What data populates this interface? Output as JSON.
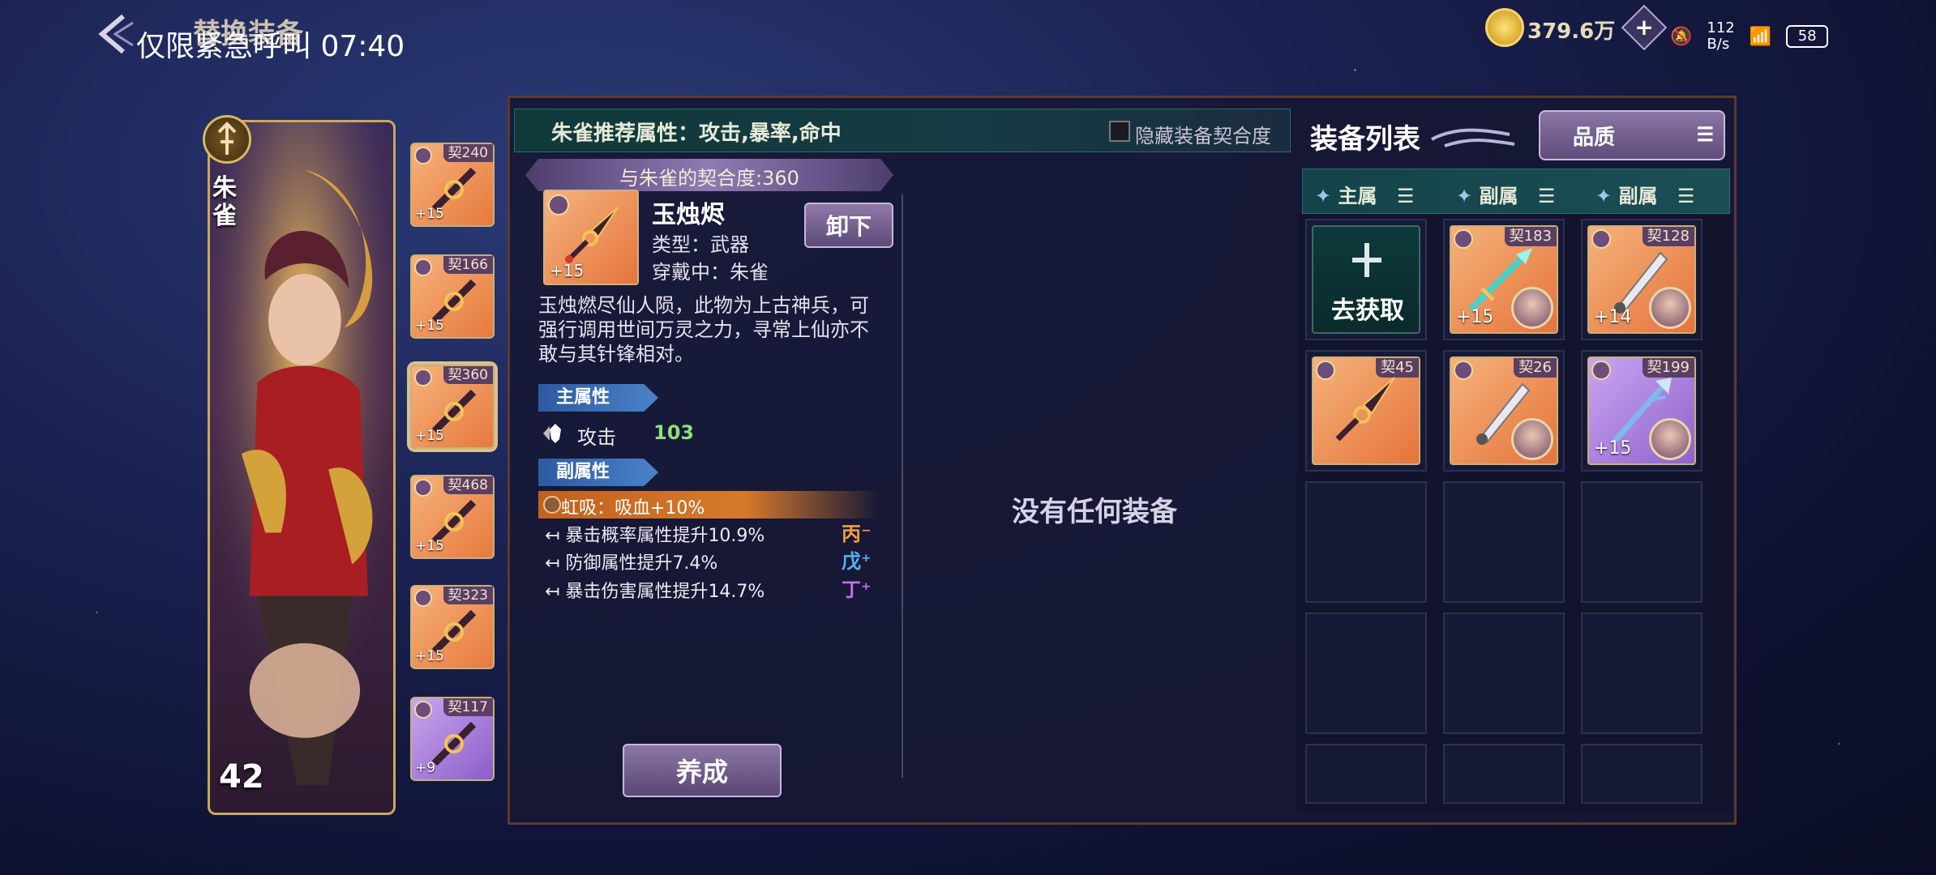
{
  "status_bar": {
    "carrier": "仅限紧急呼叫",
    "time": "07:40",
    "net_speed": "112\nB/s",
    "battery": "58"
  },
  "header": {
    "title": "替换装备",
    "currency_value": "379.6万"
  },
  "character": {
    "name": "朱雀",
    "level": "42"
  },
  "equipped_slots": [
    {
      "qiao": "契240",
      "level": "+15",
      "rarity": "orange"
    },
    {
      "qiao": "契166",
      "level": "+15",
      "rarity": "orange"
    },
    {
      "qiao": "契360",
      "level": "+15",
      "rarity": "orange",
      "selected": true
    },
    {
      "qiao": "契468",
      "level": "+15",
      "rarity": "orange"
    },
    {
      "qiao": "契323",
      "level": "+15",
      "rarity": "orange"
    },
    {
      "qiao": "契117",
      "level": "+9",
      "rarity": "purple"
    }
  ],
  "detail": {
    "recommend_text": "朱雀推荐属性：攻击,暴率,命中",
    "hide_qiao_label": "隐藏装备契合度",
    "qiao_bar": "与朱雀的契合度:360",
    "item_level": "+15",
    "item_name": "玉烛烬",
    "item_type": "类型：武器",
    "item_wearing": "穿戴中：朱雀",
    "unequip_label": "卸下",
    "description": "玉烛燃尽仙人陨，此物为上古神兵，可强行调用世间万灵之力，寻常上仙亦不敢与其针锋相对。",
    "main_attr_header": "主属性",
    "main_attr_name": "攻击",
    "main_attr_value": "103",
    "sub_attr_header": "副属性",
    "special_attr": "虹吸：吸血+10%",
    "sub_attrs": [
      {
        "text": "暴击概率属性提升10.9%",
        "tag": "丙⁻",
        "tag_color": "#f0a040"
      },
      {
        "text": "防御属性提升7.4%",
        "tag": "戊⁺",
        "tag_color": "#5ab0f0"
      },
      {
        "text": "暴击伤害属性提升14.7%",
        "tag": "丁⁺",
        "tag_color": "#c56ef0"
      }
    ],
    "train_label": "养成",
    "empty_message": "没有任何装备"
  },
  "equipment_list": {
    "title": "装备列表",
    "quality_label": "品质",
    "filters": [
      "主属",
      "副属",
      "副属"
    ],
    "get_label": "去获取",
    "items": [
      {
        "qiao": "契183",
        "level": "+15",
        "rarity": "orange",
        "weapon": "jade-sword-icon"
      },
      {
        "qiao": "契128",
        "level": "+14",
        "rarity": "orange",
        "weapon": "silver-blade-icon"
      },
      {
        "qiao": "契45",
        "level": "",
        "rarity": "orange",
        "weapon": "dagger-icon"
      },
      {
        "qiao": "契26",
        "level": "",
        "rarity": "orange",
        "weapon": "silver-blade-icon"
      },
      {
        "qiao": "契199",
        "level": "+15",
        "rarity": "purple",
        "weapon": "trident-icon"
      }
    ]
  }
}
